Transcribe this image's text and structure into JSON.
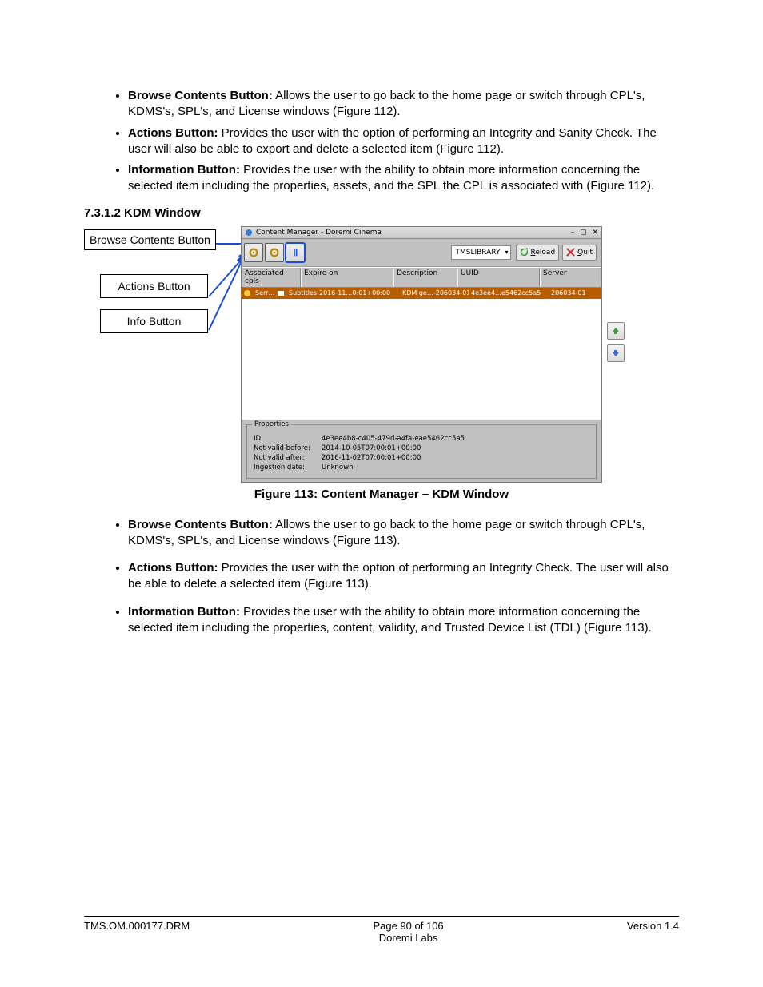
{
  "bullets_top": [
    {
      "term": "Browse Contents Button:",
      "text": " Allows the user to go back to the home page or switch through CPL's, KDMS's, SPL's, and License windows (Figure 112)."
    },
    {
      "term": "Actions Button:",
      "text": " Provides the user with the option of performing an Integrity and Sanity Check. The user will also be able to export and delete a selected item (Figure 112)."
    },
    {
      "term": "Information Button:",
      "text": " Provides the user with the ability to obtain more information concerning the selected item including the properties, assets, and the SPL the CPL is associated with (Figure 112)."
    }
  ],
  "heading": "7.3.1.2 KDM Window",
  "callouts": {
    "browse": "Browse Contents Button",
    "actions": "Actions Button",
    "info": "Info Button"
  },
  "figure_caption": "Figure 113: Content Manager – KDM Window",
  "bullets_bottom": [
    {
      "term": "Browse Contents Button:",
      "text": " Allows the user to go back to the home page or switch through CPL's, KDMS's, SPL's, and License windows (Figure 113)."
    },
    {
      "term": "Actions Button:",
      "text": " Provides the user with the option of performing an Integrity Check. The user will also be able to delete a selected item (Figure 113)."
    },
    {
      "term": "Information Button:",
      "text": " Provides the user with the ability to obtain more information concerning the selected item including the properties, content, validity, and Trusted Device List (TDL) (Figure 113)."
    }
  ],
  "app": {
    "title": "Content Manager - Doremi Cinema",
    "combo": "TMSLIBRARY",
    "reload": "Reload",
    "quit": "Quit",
    "columns": {
      "c1": "Associated cpls",
      "c2": "Expire on",
      "c3": "Description",
      "c4": "UUID",
      "c5": "Server"
    },
    "row": {
      "c1_a": "Serr…",
      "c1_b": "Subtitles",
      "c2": "2016-11…0:01+00:00",
      "c3": "KDM ge…-206034-01",
      "c4": "4e3ee4…e5462cc5a5",
      "c5": "206034-01"
    },
    "props_title": "Properties",
    "props": {
      "id_label": "ID:",
      "id_val": "4e3ee4b8-c405-479d-a4fa-eae5462cc5a5",
      "nvb_label": "Not valid before:",
      "nvb_val": "2014-10-05T07:00:01+00:00",
      "nva_label": "Not valid after:",
      "nva_val": "2016-11-02T07:00:01+00:00",
      "ing_label": "Ingestion date:",
      "ing_val": "Unknown"
    }
  },
  "footer": {
    "left": "TMS.OM.000177.DRM",
    "center1": "Page 90 of 106",
    "center2": "Doremi Labs",
    "right": "Version 1.4"
  }
}
